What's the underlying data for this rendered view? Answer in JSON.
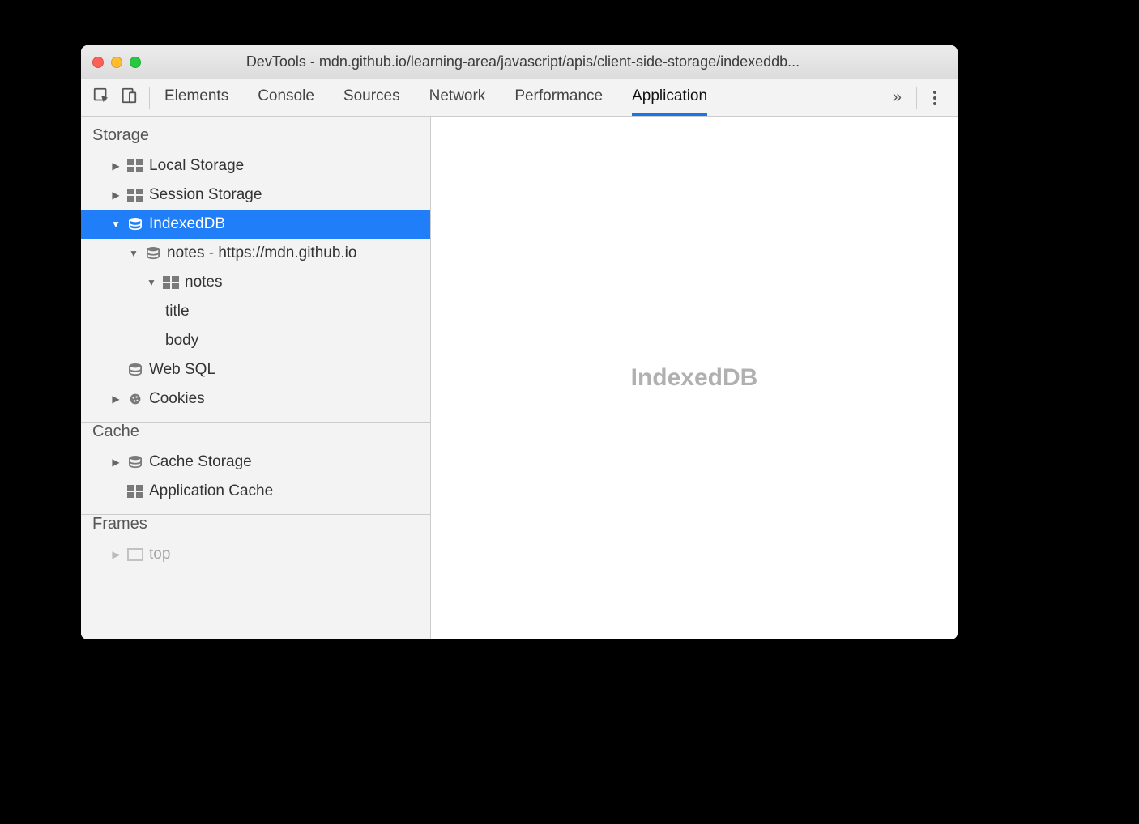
{
  "window": {
    "title": "DevTools - mdn.github.io/learning-area/javascript/apis/client-side-storage/indexeddb..."
  },
  "tabs": {
    "items": [
      "Elements",
      "Console",
      "Sources",
      "Network",
      "Performance",
      "Application"
    ],
    "active": "Application",
    "overflow_glyph": "»"
  },
  "sidebar": {
    "storage": {
      "header": "Storage",
      "local_storage": "Local Storage",
      "session_storage": "Session Storage",
      "indexeddb": {
        "label": "IndexedDB",
        "db": "notes - https://mdn.github.io",
        "store": "notes",
        "indexes": [
          "title",
          "body"
        ]
      },
      "web_sql": "Web SQL",
      "cookies": "Cookies"
    },
    "cache": {
      "header": "Cache",
      "cache_storage": "Cache Storage",
      "application_cache": "Application Cache"
    },
    "frames": {
      "header": "Frames",
      "top": "top"
    }
  },
  "main": {
    "placeholder": "IndexedDB"
  }
}
